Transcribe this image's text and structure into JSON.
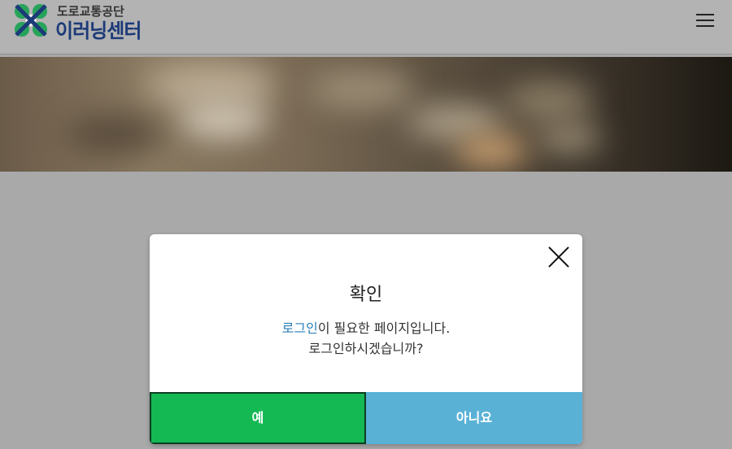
{
  "header": {
    "logo_top": "도로교통공단",
    "logo_main": "이러닝센터",
    "logo_icon": "clover-cross-logo",
    "menu_icon": "hamburger-menu-icon"
  },
  "modal": {
    "title": "확인",
    "message_highlight": "로그인",
    "message_line1_rest": "이 필요한 페이지입니다.",
    "message_line2": "로그인하시겠습니까?",
    "yes_label": "예",
    "no_label": "아니요",
    "close_icon": "close-icon"
  },
  "colors": {
    "yes_button": "#14b954",
    "no_button": "#59b1d6",
    "highlight_text": "#2a7fb8",
    "logo_green": "#27a35a",
    "logo_navy": "#1c3a78"
  }
}
